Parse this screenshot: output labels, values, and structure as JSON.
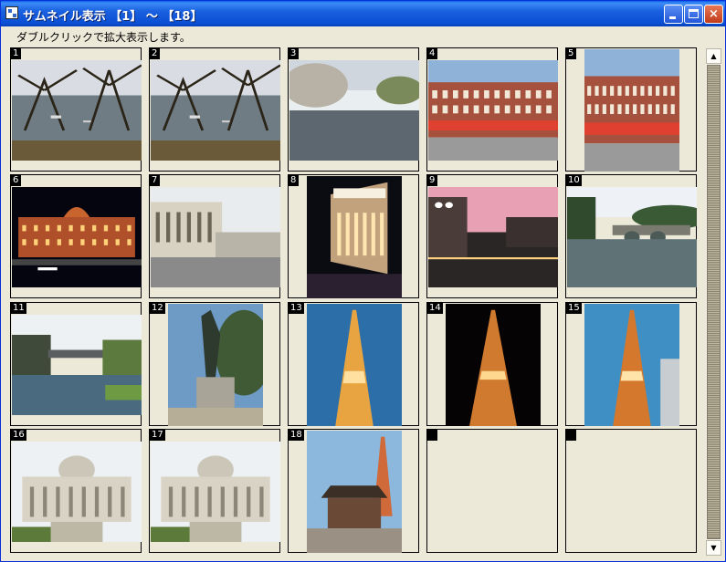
{
  "window": {
    "title": "サムネイル表示 【1】 ～ 【18】",
    "instruction": "ダブルクリックで拡大表示します。",
    "controls": {
      "minimize": "_",
      "maximize": "□",
      "close": "×"
    }
  },
  "thumbnails": [
    {
      "n": "1",
      "subject": "park pond with bare trees",
      "theme": "park"
    },
    {
      "n": "2",
      "subject": "pond path with trees and boats",
      "theme": "park"
    },
    {
      "n": "3",
      "subject": "lake with cherry blossoms",
      "theme": "lake"
    },
    {
      "n": "4",
      "subject": "Tokyo Station red brick building",
      "theme": "station"
    },
    {
      "n": "5",
      "subject": "Tokyo Station dome, portrait",
      "theme": "station"
    },
    {
      "n": "6",
      "subject": "Tokyo Station illuminated at night",
      "theme": "night-station"
    },
    {
      "n": "7",
      "subject": "street with station building",
      "theme": "street"
    },
    {
      "n": "8",
      "subject": "lit station facade at night",
      "theme": "night-building"
    },
    {
      "n": "9",
      "subject": "city at dusk with pink sky",
      "theme": "dusk"
    },
    {
      "n": "10",
      "subject": "Nijubashi bridge over moat",
      "theme": "bridge"
    },
    {
      "n": "11",
      "subject": "moat with bridge and stone wall",
      "theme": "moat"
    },
    {
      "n": "12",
      "subject": "samurai statue",
      "theme": "statue"
    },
    {
      "n": "13",
      "subject": "Tokyo Tower lit, blue sky",
      "theme": "tower-dusk"
    },
    {
      "n": "14",
      "subject": "Tokyo Tower lit at night",
      "theme": "tower-night"
    },
    {
      "n": "15",
      "subject": "Tokyo Tower lit at dusk",
      "theme": "tower-dusk2"
    },
    {
      "n": "16",
      "subject": "Tsukiji Hongwanji temple",
      "theme": "temple"
    },
    {
      "n": "17",
      "subject": "Tsukiji Hongwanji temple front",
      "theme": "temple"
    },
    {
      "n": "18",
      "subject": "temple gate with Tokyo Tower",
      "theme": "gate-tower"
    },
    {
      "n": "",
      "subject": "empty",
      "theme": "empty"
    },
    {
      "n": "",
      "subject": "empty",
      "theme": "empty"
    }
  ],
  "scrollbar": {
    "up_arrow": "▲",
    "down_arrow": "▼"
  }
}
